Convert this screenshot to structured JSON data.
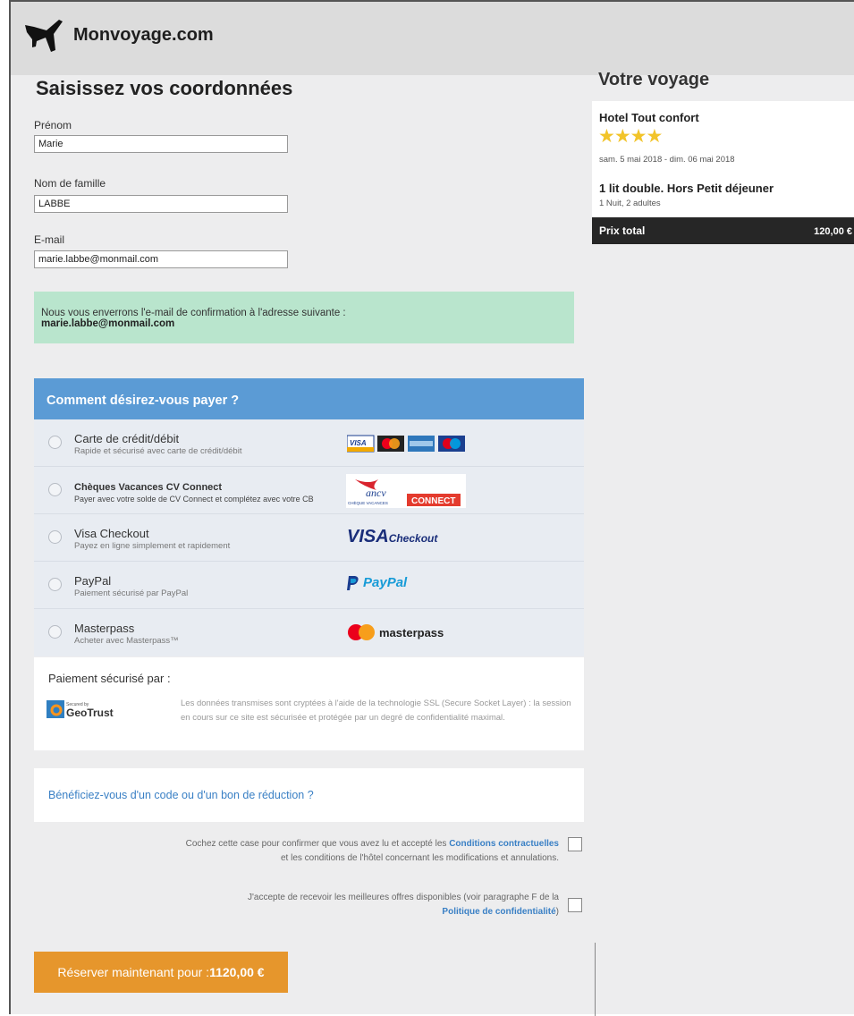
{
  "brand": {
    "name": "Monvoyage.com"
  },
  "form": {
    "title": "Saisissez vos coordonnées",
    "first_name": {
      "label": "Prénom",
      "value": "Marie"
    },
    "last_name": {
      "label": "Nom de famille",
      "value": "LABBE"
    },
    "email": {
      "label": "E-mail",
      "value": "marie.labbe@monmail.com"
    },
    "notice_text": "Nous vous enverrons l'e-mail de confirmation à l'adresse suivante :",
    "notice_email": "marie.labbe@monmail.com"
  },
  "payment": {
    "heading": "Comment désirez-vous payer ?",
    "options": [
      {
        "title": "Carte de crédit/débit",
        "subtitle": "Rapide et sécurisé avec carte de crédit/débit"
      },
      {
        "title": "Chèques Vacances CV Connect",
        "subtitle": "Payer avec votre solde de CV Connect et complétez avec votre CB",
        "logo_text": "ancv",
        "logo_sub": "CHÈQUE VACANCES",
        "logo_badge": "CONNECT"
      },
      {
        "title": "Visa Checkout",
        "subtitle": "Payez en ligne simplement et rapidement",
        "logo_text": "VISA",
        "logo_sub": "Checkout"
      },
      {
        "title": "PayPal",
        "subtitle": "Paiement sécurisé par PayPal",
        "logo_text": "PayPal"
      },
      {
        "title": "Masterpass",
        "subtitle": "Acheter avec Masterpass™",
        "logo_text": "masterpass"
      }
    ],
    "card_logos": [
      "VISA"
    ]
  },
  "secure": {
    "title": "Paiement sécurisé par :",
    "geotrust_top": "Secured by",
    "geotrust_name": "GeoTrust",
    "text": "Les données transmises sont cryptées à l'aide de la technologie SSL (Secure Socket Layer) : la session en cours sur ce site est sécurisée et protégée par un degré de confidentialité maximal."
  },
  "promo": {
    "link": "Bénéficiez-vous d'un code ou d'un bon de réduction ?"
  },
  "terms": {
    "line1_pre": "Cochez cette case pour confirmer que vous avez lu et accepté les ",
    "line1_link": "Conditions contractuelles",
    "line2": "et les conditions de l'hôtel concernant les modifications et annulations.",
    "offers_pre": "J'accepte de recevoir les meilleures offres disponibles (voir paragraphe F de la",
    "offers_link": "Politique de confidentialité",
    "offers_post": ")"
  },
  "book": {
    "label": "Réserver maintenant pour : ",
    "amount": "1120,00 €"
  },
  "trip": {
    "title": "Votre voyage",
    "hotel": "Hotel Tout confort",
    "stars": "★★★★",
    "dates": "sam. 5 mai 2018 - dim. 06 mai 2018",
    "room": "1 lit double. Hors Petit déjeuner",
    "guests": "1 Nuit, 2 adultes",
    "total_label": "Prix total",
    "total_value": "120,00 €"
  },
  "colors": {
    "accent": "#5b9bd5",
    "button": "#e6962c",
    "notice": "#b9e5cd",
    "stars": "#f2c42a"
  }
}
